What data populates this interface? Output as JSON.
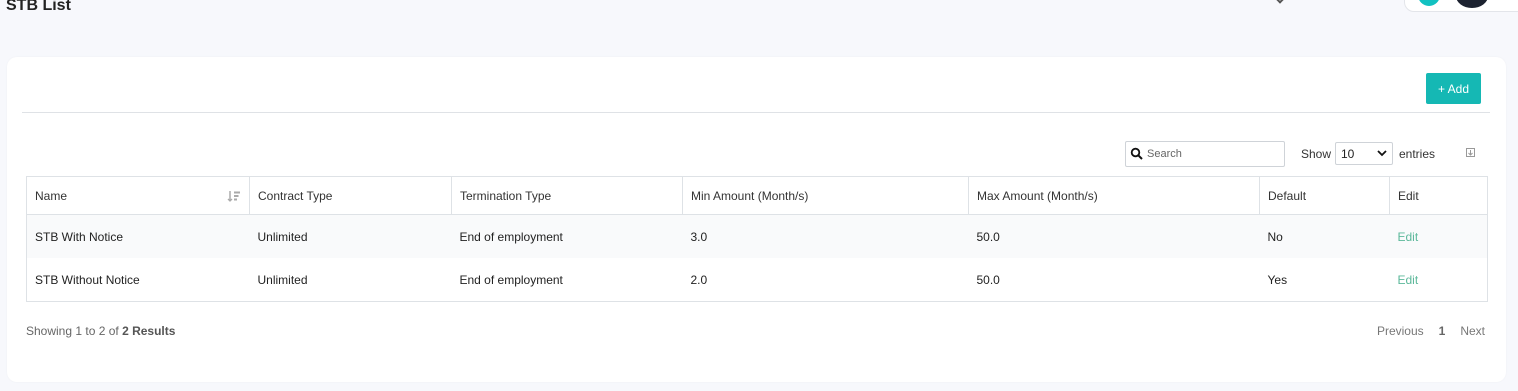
{
  "page": {
    "title": "STB List"
  },
  "toolbar": {
    "add_label": "+ Add"
  },
  "search": {
    "placeholder": "Search",
    "value": ""
  },
  "length": {
    "show_label": "Show",
    "selected": "10",
    "entries_label": "entries"
  },
  "table": {
    "columns": [
      "Name",
      "Contract Type",
      "Termination Type",
      "Min Amount (Month/s)",
      "Max Amount (Month/s)",
      "Default",
      "Edit"
    ],
    "rows": [
      {
        "name": "STB With Notice",
        "contract_type": "Unlimited",
        "termination_type": "End of employment",
        "min_amount": "3.0",
        "max_amount": "50.0",
        "default": "No",
        "edit": "Edit"
      },
      {
        "name": "STB Without Notice",
        "contract_type": "Unlimited",
        "termination_type": "End of employment",
        "min_amount": "2.0",
        "max_amount": "50.0",
        "default": "Yes",
        "edit": "Edit"
      }
    ]
  },
  "footer": {
    "showing_prefix": "Showing 1 to 2 of ",
    "showing_total": "2 Results",
    "previous": "Previous",
    "current_page": "1",
    "next": "Next"
  },
  "colors": {
    "accent": "#15b8b4",
    "edit_link": "#5cb89a",
    "avatar_teal": "#12c1c1"
  },
  "icons": [
    "search-icon",
    "sort-icon",
    "chevron-down-icon",
    "export-icon",
    "avatar"
  ]
}
